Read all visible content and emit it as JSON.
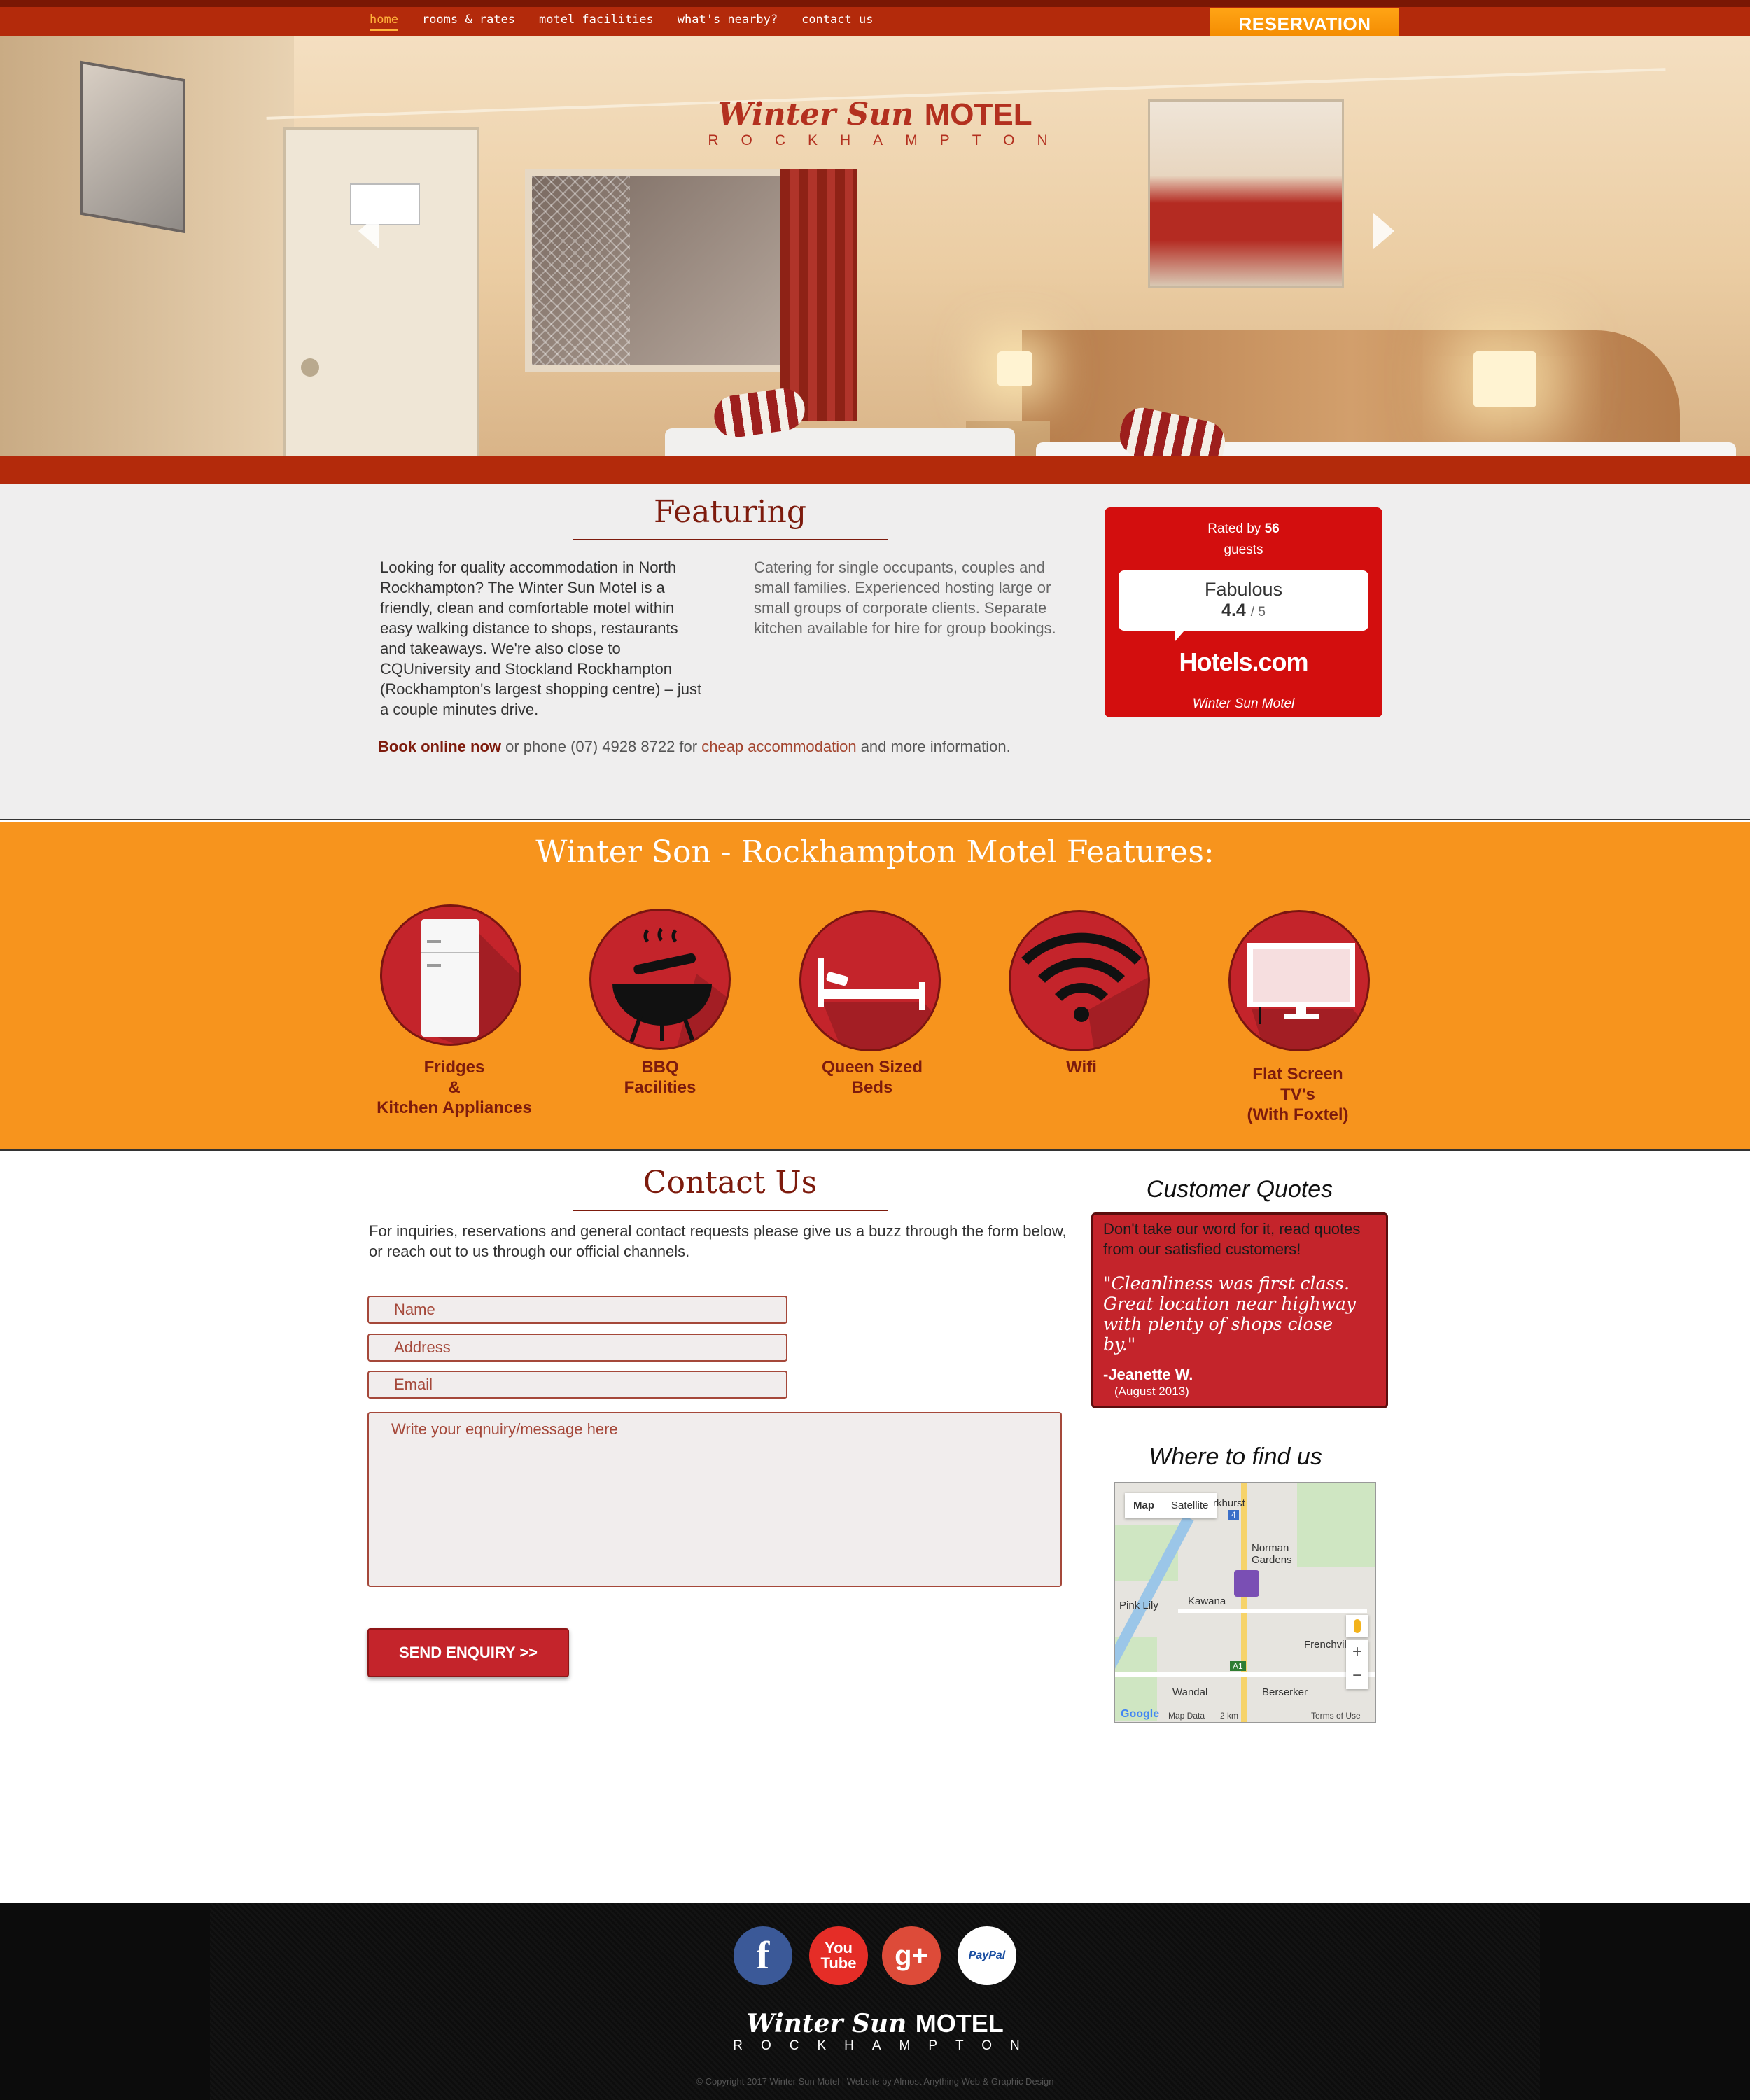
{
  "nav": {
    "items": [
      "home",
      "rooms & rates",
      "motel facilities",
      "what's nearby?",
      "contact us"
    ],
    "active": "home",
    "reservation": "RESERVATION"
  },
  "logo": {
    "name": "Winter Sun",
    "motel": "MOTEL",
    "city": "ROCKHAMPTON"
  },
  "featuring": {
    "title": "Featuring",
    "col1": "Looking for quality accommodation in North Rockhampton? The Winter Sun Motel is a friendly, clean and comfortable motel within easy walking distance to shops, restaurants and takeaways. We're also close to CQUniversity and Stockland Rockhampton (Rockhampton's largest shopping centre) – just a couple minutes drive.",
    "col2": "Catering for single occupants, couples and small families. Experienced hosting large or small groups of corporate clients. Separate kitchen available for hire for group bookings.",
    "footer_bold": "Book online now",
    "footer_mid": " or phone (07) 4928 8722 for ",
    "footer_link": "cheap accommodation",
    "footer_end": " and more information."
  },
  "rating": {
    "rated_prefix": "Rated by",
    "count": "56",
    "guests": "guests",
    "label": "Fabulous",
    "score": "4.4",
    "out_of": "/ 5",
    "brand": "Hotels.com",
    "property": "Winter Sun Motel",
    "color": "#d30e0e"
  },
  "features": {
    "title": "Winter Son - Rockhampton Motel Features:",
    "items": [
      {
        "icon": "fridge-icon",
        "label_lines": [
          "Fridges",
          "&",
          "Kitchen Appliances"
        ]
      },
      {
        "icon": "bbq-icon",
        "label_lines": [
          "BBQ",
          "Facilities"
        ]
      },
      {
        "icon": "bed-icon",
        "label_lines": [
          "Queen Sized",
          "Beds"
        ]
      },
      {
        "icon": "wifi-icon",
        "label_lines": [
          "Wifi"
        ]
      },
      {
        "icon": "tv-icon",
        "label_lines": [
          "Flat Screen",
          "TV's",
          "(With Foxtel)"
        ]
      }
    ],
    "background": "#f7941d"
  },
  "contact": {
    "title": "Contact Us",
    "intro": "For inquiries, reservations and general contact requests please give us a buzz through the form below, or reach out to us through our official channels.",
    "name_placeholder": "Name",
    "address_placeholder": "Address",
    "email_placeholder": "Email",
    "message_placeholder": "Write your eqnuiry/message here",
    "send_label": "SEND ENQUIRY >>"
  },
  "quotes": {
    "title": "Customer Quotes",
    "intro": "Don't take our word for it, read quotes from our satisfied customers!",
    "text": "\"Cleanliness was first class. Great location near highway with plenty of shops close by.\"",
    "author": "-Jeanette W.",
    "date": "(August 2013)"
  },
  "map": {
    "title": "Where to find us",
    "tab_map": "Map",
    "tab_satellite": "Satellite",
    "labels": [
      "rkhurst",
      "Norman Gardens",
      "Pink Lily",
      "Kawana",
      "Frenchville",
      "Wandal",
      "Berserker",
      "4",
      "A1"
    ],
    "footer_data": "Map Data",
    "footer_scale": "2 km",
    "footer_terms": "Terms of Use",
    "google": "Google"
  },
  "footer": {
    "social": [
      {
        "icon": "facebook-icon",
        "text": "f",
        "color": "#3b5998"
      },
      {
        "icon": "youtube-icon",
        "text": "You Tube",
        "color": "#e52d27"
      },
      {
        "icon": "googleplus-icon",
        "text": "g+",
        "color": "#dd4b39"
      },
      {
        "icon": "paypal-icon",
        "text": "PayPal",
        "color": "#ffffff"
      }
    ],
    "copyright": "© Copyright 2017 Winter Sun Motel | Website by Almost Anything Web & Graphic Design"
  }
}
